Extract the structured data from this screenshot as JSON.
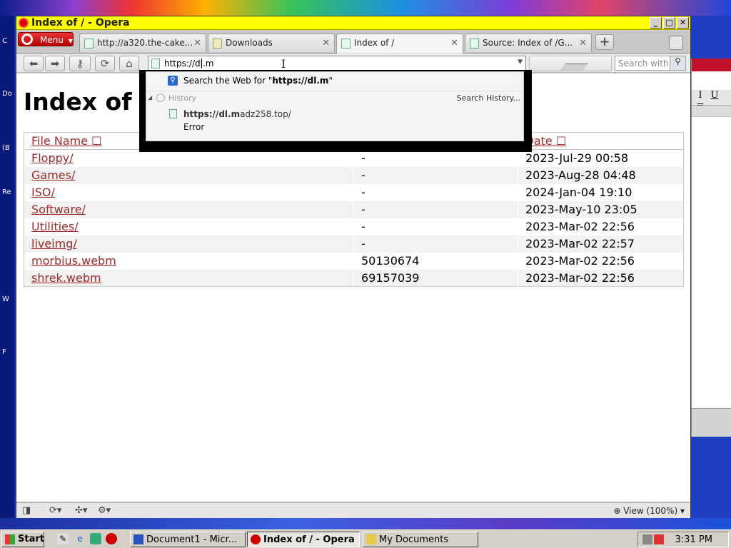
{
  "window": {
    "title": "Index of / - Opera",
    "buttons": {
      "minimize": "_",
      "maximize": "□",
      "close": "✕"
    }
  },
  "menu_button": {
    "label": "Menu"
  },
  "tabs": [
    {
      "label": "http://a320.the-cake...",
      "active": false,
      "icon": "page-icon"
    },
    {
      "label": "Downloads",
      "active": false,
      "icon": "download-icon"
    },
    {
      "label": "Index of /",
      "active": true,
      "icon": "page-icon"
    },
    {
      "label": "Source: Index of /G...",
      "active": false,
      "icon": "page-icon"
    }
  ],
  "toolbar": {
    "back": "⬅",
    "forward": "➡",
    "key": "⚷",
    "reload": "⟳",
    "home": "⌂",
    "address_value": "https://dl.m",
    "search_placeholder": "Search with",
    "search_icon": "⚲"
  },
  "autocomplete": {
    "search_prefix": "Search the Web for \"",
    "search_query": "https://dl.m",
    "search_suffix": "\"",
    "history_label": "History",
    "search_history_label": "Search History...",
    "item_url_bold": "https://dl.m",
    "item_url_rest": "adz258.top/",
    "item_subtitle": "Error"
  },
  "page": {
    "heading": "Index of",
    "columns": {
      "name": "File Name",
      "date": "Date",
      "sort_icon": "☐"
    },
    "rows": [
      {
        "name": "Floppy/",
        "size": "-",
        "date": "2023-Jul-29 00:58"
      },
      {
        "name": "Games/",
        "size": "-",
        "date": "2023-Aug-28 04:48"
      },
      {
        "name": "ISO/",
        "size": "-",
        "date": "2024-Jan-04 19:10"
      },
      {
        "name": "Software/",
        "size": "-",
        "date": "2023-May-10 23:05"
      },
      {
        "name": "Utilities/",
        "size": "-",
        "date": "2023-Mar-02 22:56"
      },
      {
        "name": "liveimg/",
        "size": "-",
        "date": "2023-Mar-02 22:57"
      },
      {
        "name": "morbius.webm",
        "size": "50130674",
        "date": "2023-Mar-02 22:56"
      },
      {
        "name": "shrek.webm",
        "size": "69157039",
        "date": "2023-Mar-02 22:56"
      }
    ]
  },
  "statusbar": {
    "zoom": "View (100%)"
  },
  "taskbar": {
    "start": "Start",
    "tasks": [
      {
        "label": "Document1 - Micr...",
        "active": false
      },
      {
        "label": "Index of / - Opera",
        "active": true
      },
      {
        "label": "My Documents",
        "active": false
      }
    ],
    "clock": "3:31 PM"
  },
  "desktop": {
    "icon_labels": [
      "C",
      "Do",
      "(B",
      "Re",
      "W",
      "F"
    ],
    "toolbar_letters": [
      "I",
      "U",
      "≡"
    ]
  },
  "colors": {
    "titlebar": "#ffff00",
    "link": "#9e2a2a",
    "opera_red": "#cc0000"
  }
}
